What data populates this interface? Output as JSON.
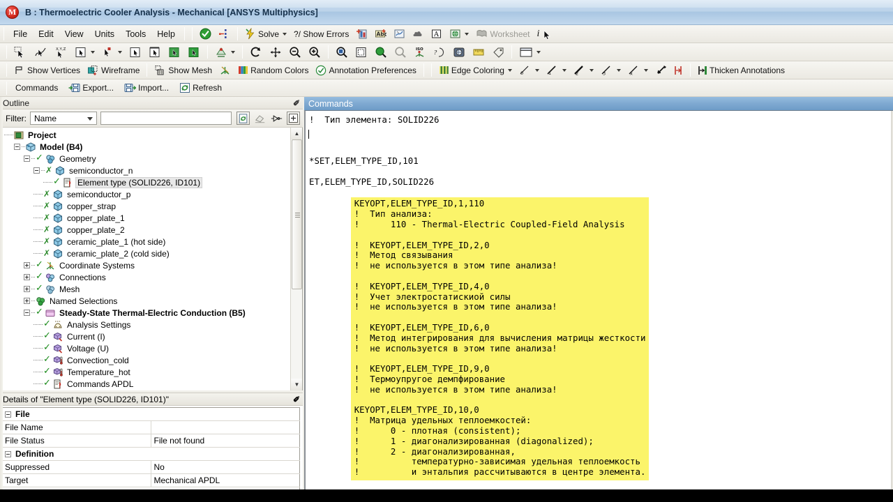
{
  "window": {
    "title": "B : Thermoelectric Cooler Analysis - Mechanical [ANSYS Multiphysics]",
    "logo_glyph": "M"
  },
  "menubar": {
    "items": [
      {
        "label": "File",
        "name": "menu-file"
      },
      {
        "label": "Edit",
        "name": "menu-edit"
      },
      {
        "label": "View",
        "name": "menu-view"
      },
      {
        "label": "Units",
        "name": "menu-units"
      },
      {
        "label": "Tools",
        "name": "menu-tools"
      },
      {
        "label": "Help",
        "name": "menu-help"
      }
    ],
    "solve_label": "Solve",
    "show_errors_label": "?/ Show Errors",
    "worksheet_label": "Worksheet",
    "info_label": "i"
  },
  "toolbar_display": {
    "show_vertices": "Show Vertices",
    "wireframe": "Wireframe",
    "show_mesh": "Show Mesh",
    "random_colors": "Random Colors",
    "annotation_preferences": "Annotation Preferences",
    "edge_coloring": "Edge Coloring",
    "thicken_annotations": "Thicken Annotations"
  },
  "toolbar_context": {
    "commands": "Commands",
    "export": "Export...",
    "import": "Import...",
    "refresh": "Refresh"
  },
  "outline": {
    "caption": "Outline",
    "pin": "✐",
    "filter_label": "Filter:",
    "filter_value": "Name",
    "filter_text": "",
    "filter_placeholder": "",
    "tree": [
      {
        "label": "Project",
        "indent": 0,
        "icon": "project-icon",
        "bold": true,
        "expander": "none",
        "check": "none",
        "selected": false
      },
      {
        "label": "Model (B4)",
        "indent": 1,
        "icon": "model-icon",
        "bold": true,
        "expander": "minus",
        "check": "none",
        "selected": false
      },
      {
        "label": "Geometry",
        "indent": 2,
        "icon": "geometry-icon",
        "bold": false,
        "expander": "minus",
        "check": "green",
        "selected": false
      },
      {
        "label": "semiconductor_n",
        "indent": 3,
        "icon": "body-icon",
        "bold": false,
        "expander": "minus",
        "check": "x",
        "selected": false
      },
      {
        "label": "Element type (SOLID226, ID101)",
        "indent": 4,
        "icon": "commands-icon",
        "bold": false,
        "expander": "none",
        "check": "green",
        "selected": true
      },
      {
        "label": "semiconductor_p",
        "indent": 3,
        "icon": "body-icon",
        "bold": false,
        "expander": "none",
        "check": "x",
        "selected": false
      },
      {
        "label": "copper_strap",
        "indent": 3,
        "icon": "body-icon",
        "bold": false,
        "expander": "none",
        "check": "x",
        "selected": false
      },
      {
        "label": "copper_plate_1",
        "indent": 3,
        "icon": "body-icon",
        "bold": false,
        "expander": "none",
        "check": "x",
        "selected": false
      },
      {
        "label": "copper_plate_2",
        "indent": 3,
        "icon": "body-icon",
        "bold": false,
        "expander": "none",
        "check": "x",
        "selected": false
      },
      {
        "label": "ceramic_plate_1 (hot side)",
        "indent": 3,
        "icon": "body-icon",
        "bold": false,
        "expander": "none",
        "check": "x",
        "selected": false
      },
      {
        "label": "ceramic_plate_2 (cold side)",
        "indent": 3,
        "icon": "body-icon",
        "bold": false,
        "expander": "none",
        "check": "x",
        "selected": false
      },
      {
        "label": "Coordinate Systems",
        "indent": 2,
        "icon": "coordinate-systems-icon",
        "bold": false,
        "expander": "plus",
        "check": "green",
        "selected": false
      },
      {
        "label": "Connections",
        "indent": 2,
        "icon": "connections-icon",
        "bold": false,
        "expander": "plus",
        "check": "green",
        "selected": false
      },
      {
        "label": "Mesh",
        "indent": 2,
        "icon": "mesh-icon",
        "bold": false,
        "expander": "plus",
        "check": "green",
        "selected": false
      },
      {
        "label": "Named Selections",
        "indent": 2,
        "icon": "named-selections-icon",
        "bold": false,
        "expander": "plus",
        "check": "none",
        "selected": false
      },
      {
        "label": "Steady-State Thermal-Electric Conduction (B5)",
        "indent": 2,
        "icon": "analysis-icon",
        "bold": true,
        "expander": "minus",
        "check": "green",
        "selected": false
      },
      {
        "label": "Analysis Settings",
        "indent": 3,
        "icon": "analysis-settings-icon",
        "bold": false,
        "expander": "none",
        "check": "green",
        "selected": false
      },
      {
        "label": "Current (I)",
        "indent": 3,
        "icon": "current-load-icon",
        "bold": false,
        "expander": "none",
        "check": "green",
        "selected": false
      },
      {
        "label": "Voltage (U)",
        "indent": 3,
        "icon": "voltage-load-icon",
        "bold": false,
        "expander": "none",
        "check": "green",
        "selected": false
      },
      {
        "label": "Convection_cold",
        "indent": 3,
        "icon": "convection-icon",
        "bold": false,
        "expander": "none",
        "check": "green",
        "selected": false
      },
      {
        "label": "Temperature_hot",
        "indent": 3,
        "icon": "temperature-icon",
        "bold": false,
        "expander": "none",
        "check": "green",
        "selected": false
      },
      {
        "label": "Commands APDL",
        "indent": 3,
        "icon": "commands-icon",
        "bold": false,
        "expander": "none",
        "check": "green",
        "selected": false
      }
    ]
  },
  "details": {
    "caption": "Details of \"Element type (SOLID226, ID101)\"",
    "pin": "✐",
    "rows": [
      {
        "type": "group",
        "key": "File",
        "value": ""
      },
      {
        "type": "row",
        "key": "File Name",
        "value": ""
      },
      {
        "type": "row",
        "key": "File Status",
        "value": "File not found"
      },
      {
        "type": "group",
        "key": "Definition",
        "value": ""
      },
      {
        "type": "row",
        "key": "Suppressed",
        "value": "No"
      },
      {
        "type": "row",
        "key": "Target",
        "value": "Mechanical APDL"
      }
    ]
  },
  "commands": {
    "caption": "Commands",
    "top_code": "!  Тип элемента: SOLID226\n\n\n\n*SET,ELEM_TYPE_ID,101\n\nET,ELEM_TYPE_ID,SOLID226\n",
    "highlighted_code": "KEYOPT,ELEM_TYPE_ID,1,110\n!  Тип анализа:\n!      110 - Thermal-Electric Coupled-Field Analysis\n\n!  KEYOPT,ELEM_TYPE_ID,2,0\n!  Метод связывания\n!  не используется в этом типе анализа!\n\n!  KEYOPT,ELEM_TYPE_ID,4,0\n!  Учет электростатискиой силы\n!  не используется в этом типе анализа!\n\n!  KEYOPT,ELEM_TYPE_ID,6,0\n!  Метод интегрирования для вычисления матрицы жесткости\n!  не используется в этом типе анализа!\n\n!  KEYOPT,ELEM_TYPE_ID,9,0\n!  Термоупругое демпфирование\n!  не используется в этом типе анализа!\n\nKEYOPT,ELEM_TYPE_ID,10,0\n!  Матрица удельных теплоемкостей:\n!      0 - плотная (consistent);\n!      1 - диагонализированная (diagonalized);\n!      2 - диагонализированная,\n!          температурно-зависимая удельная теплоемкость\n!          и энтальпия рассчитываются в центре элемента."
  },
  "colors": {
    "titlebar": "#bcd3ea",
    "highlight_yellow": "#fbf46a",
    "commands_caption": "#7fa9d1",
    "check_green": "#1a8a1a"
  }
}
